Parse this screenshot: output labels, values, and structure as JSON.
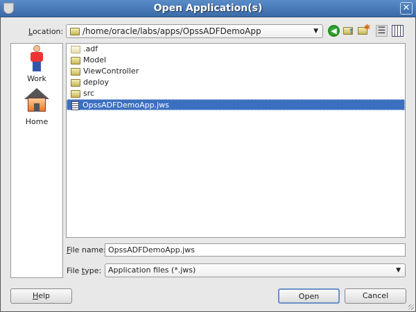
{
  "window": {
    "title": "Open Application(s)",
    "close": "✕"
  },
  "location": {
    "label_u": "L",
    "label_rest": "ocation:",
    "value": "/home/oracle/labs/apps/OpssADFDemoApp"
  },
  "toolbar": {
    "icons": [
      "back-icon",
      "up-folder-icon",
      "new-folder-icon",
      "list-view-icon",
      "details-view-icon"
    ]
  },
  "places": [
    {
      "label": "Work"
    },
    {
      "label": "Home"
    }
  ],
  "files": [
    {
      "name": ".adf",
      "type": "folder"
    },
    {
      "name": "Model",
      "type": "folder"
    },
    {
      "name": "ViewController",
      "type": "folder"
    },
    {
      "name": "deploy",
      "type": "folder"
    },
    {
      "name": "src",
      "type": "folder"
    },
    {
      "name": "OpssADFDemoApp.jws",
      "type": "file",
      "selected": true
    }
  ],
  "file_name": {
    "label_u": "F",
    "label_rest": "ile name:",
    "value": "OpssADFDemoApp.jws"
  },
  "file_type": {
    "label_pre": "File ",
    "label_u": "t",
    "label_rest": "ype:",
    "value": "Application files (*.jws)"
  },
  "buttons": {
    "help_u": "H",
    "help_rest": "elp",
    "open": "Open",
    "cancel": "Cancel"
  }
}
